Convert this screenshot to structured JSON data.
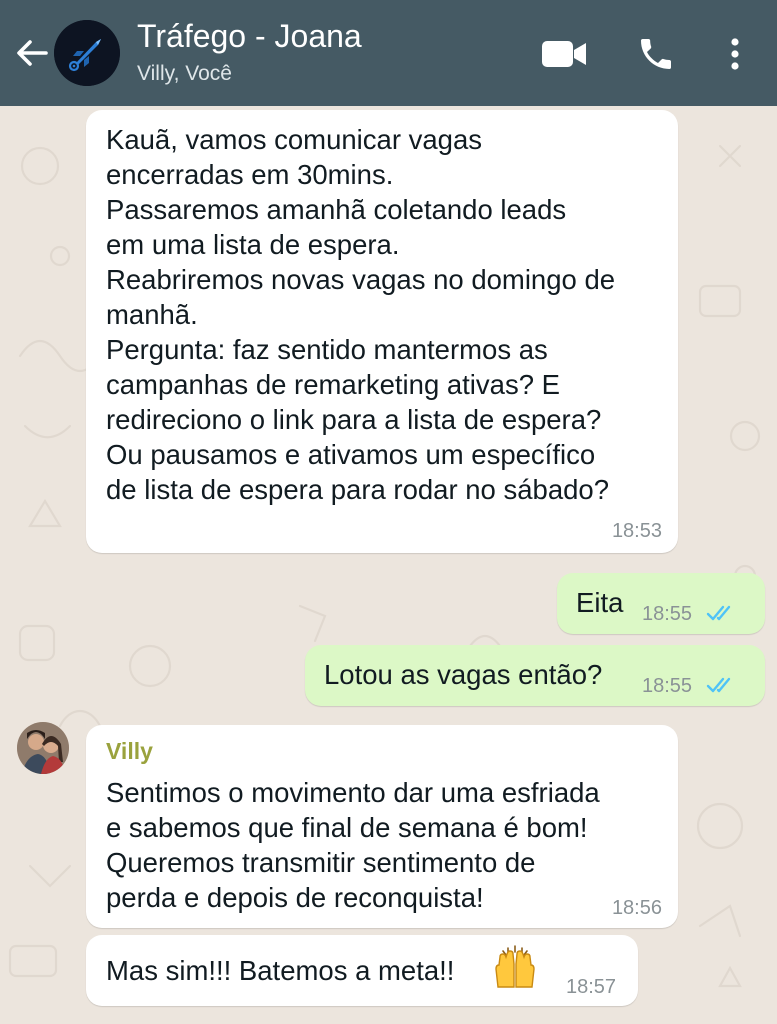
{
  "header": {
    "title": "Tráfego - Joana",
    "subtitle": "Villy, Você",
    "back_icon": "arrow-left-icon",
    "video_icon": "video-camera-icon",
    "call_icon": "phone-icon",
    "menu_icon": "more-vertical-icon",
    "background_color": "#455a64"
  },
  "colors": {
    "incoming_bubble": "#ffffff",
    "outgoing_bubble": "#dcf8c6",
    "read_ticks": "#4fc3f7",
    "sender_name": "#9aa23d",
    "chat_background": "#ece5dd"
  },
  "messages": [
    {
      "direction": "incoming",
      "lines": [
        "Kauã, vamos comunicar vagas",
        "encerradas em 30mins.",
        "Passaremos amanhã coletando leads",
        "em uma lista de espera.",
        "Reabriremos novas vagas no domingo de",
        "manhã.",
        "Pergunta: faz sentido mantermos as",
        "campanhas de remarketing ativas? E",
        "redireciono o link para a lista de espera?",
        "Ou pausamos e ativamos um específico",
        "de lista de espera para rodar no sábado?"
      ],
      "time": "18:53"
    },
    {
      "direction": "outgoing",
      "text": "Eita",
      "time": "18:55",
      "status": "read"
    },
    {
      "direction": "outgoing",
      "text": "Lotou as vagas então?",
      "time": "18:55",
      "status": "read"
    },
    {
      "direction": "incoming",
      "sender": "Villy",
      "lines": [
        "Sentimos o movimento dar uma esfriada",
        "e sabemos que final de semana é bom!",
        "Queremos transmitir sentimento de",
        "perda e depois de reconquista!"
      ],
      "time": "18:56"
    },
    {
      "direction": "incoming",
      "text": "Mas sim!!! Batemos a meta!!",
      "emoji": "raising-hands-emoji",
      "time": "18:57"
    }
  ]
}
